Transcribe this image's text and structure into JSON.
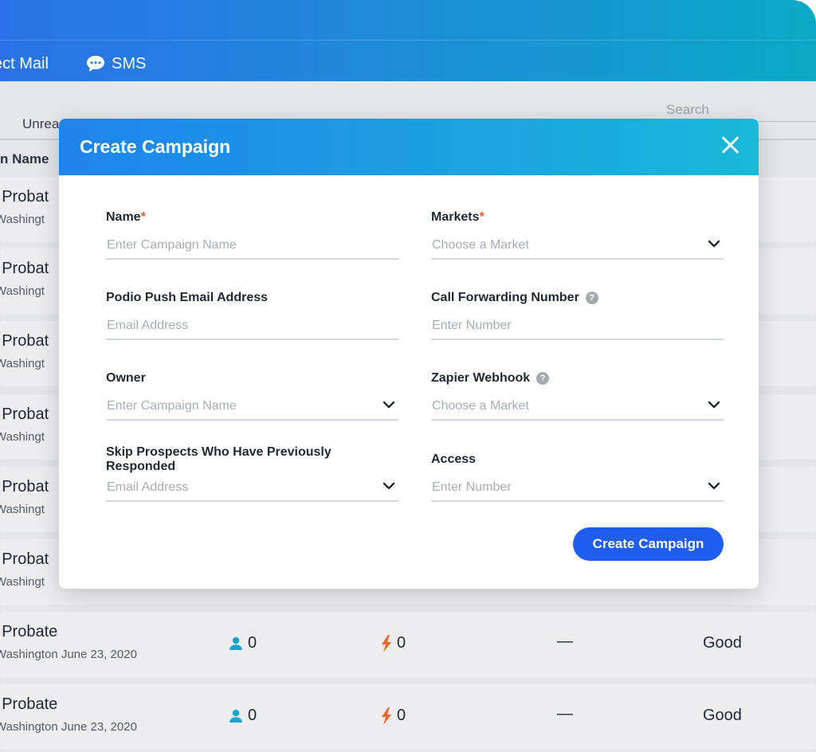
{
  "app": {
    "nav": {
      "direct_mail": "ect Mail",
      "sms": "SMS"
    },
    "filter_tab": "Unrea",
    "search_placeholder": "Search",
    "column_header": "n Name",
    "rows": [
      {
        "title": "r Probat",
        "sub": "Washingt"
      },
      {
        "title": "r Probat",
        "sub": "Washingt"
      },
      {
        "title": "r Probat",
        "sub": "Washingt"
      },
      {
        "title": "r Probat",
        "sub": "Washingt"
      },
      {
        "title": "r Probat",
        "sub": "Washingt"
      },
      {
        "title": "r Probat",
        "sub": "Washingt"
      },
      {
        "title": "r Probate",
        "sub": "Washington June 23, 2020",
        "leads": "0",
        "hot": "0",
        "dash": "—",
        "health": "Good"
      },
      {
        "title": "r Probate",
        "sub": "Washington June 23, 2020",
        "leads": "0",
        "hot": "0",
        "dash": "—",
        "health": "Good"
      }
    ]
  },
  "modal": {
    "title": "Create Campaign",
    "fields": {
      "name": {
        "label": "Name",
        "required_mark": "*",
        "placeholder": "Enter Campaign Name"
      },
      "markets": {
        "label": "Markets",
        "required_mark": "*",
        "placeholder": "Choose a Market"
      },
      "podio_email": {
        "label": "Podio Push Email Address",
        "placeholder": "Email Address"
      },
      "call_forwarding": {
        "label": "Call Forwarding Number",
        "placeholder": "Enter Number"
      },
      "owner": {
        "label": "Owner",
        "placeholder": "Enter Campaign Name"
      },
      "zapier": {
        "label": "Zapier Webhook",
        "placeholder": "Choose a Market"
      },
      "skip_prospects": {
        "label": "Skip Prospects Who Have Previously Responded",
        "placeholder": "Email Address"
      },
      "access": {
        "label": "Access",
        "placeholder": "Enter Number"
      }
    },
    "submit_label": "Create Campaign"
  },
  "colors": {
    "accent": "#1f5ef0",
    "required": "#e8632d",
    "lead_icon": "#1aa3c9",
    "hot_icon": "#ec6a2c"
  },
  "icons": [
    "sms-icon",
    "close-icon",
    "help-icon",
    "chevron-down-icon",
    "user-icon",
    "lightning-icon"
  ]
}
